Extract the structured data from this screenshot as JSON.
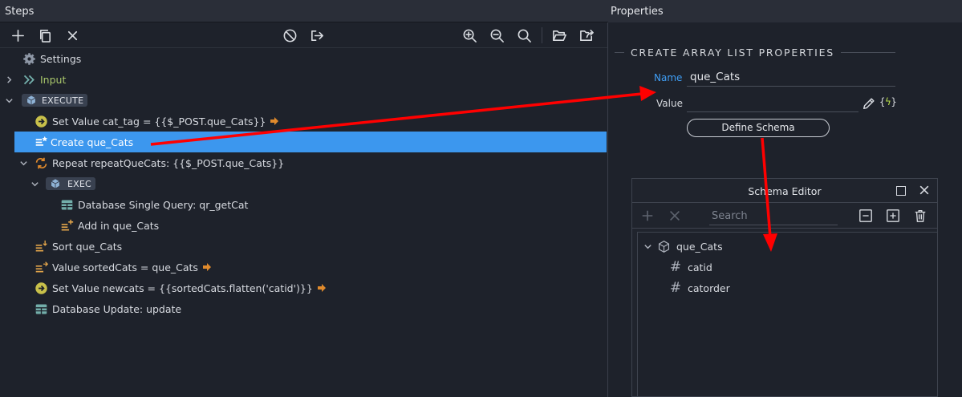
{
  "steps_panel": {
    "title": "Steps",
    "rows": [
      {
        "label": "Settings"
      },
      {
        "label": "Input"
      },
      {
        "label": "EXECUTE"
      },
      {
        "label": "Set Value cat_tag = {{$_POST.que_Cats}}"
      },
      {
        "label": "Create que_Cats"
      },
      {
        "label": "Repeat repeatQueCats: {{$_POST.que_Cats}}"
      },
      {
        "label": "EXEC"
      },
      {
        "label": "Database Single Query: qr_getCat"
      },
      {
        "label": "Add in que_Cats"
      },
      {
        "label": "Sort que_Cats"
      },
      {
        "label": "Value sortedCats = que_Cats"
      },
      {
        "label": "Set Value newcats = {{sortedCats.flatten('catid')}}"
      },
      {
        "label": "Database Update: update"
      }
    ]
  },
  "properties_panel": {
    "title": "Properties",
    "section_title": "CREATE ARRAY LIST PROPERTIES",
    "name_label": "Name",
    "name_value": "que_Cats",
    "value_label": "Value",
    "value_value": "",
    "dynamic_open": "{",
    "dynamic_bolt": "ϟ",
    "dynamic_close": "}",
    "define_schema_label": "Define Schema"
  },
  "schema_editor": {
    "title": "Schema Editor",
    "search_placeholder": "Search",
    "root": "que_Cats",
    "fields": [
      "catid",
      "catorder"
    ]
  },
  "colors": {
    "selection": "#3c97ee",
    "accent_blue": "#3f9ef5",
    "input_green": "#a8c66b",
    "annotation_arrow": "#ff0000",
    "set_value_icon": "#c8c04a",
    "repeat_icon": "#e08a2c",
    "db_icon": "#73aeaa"
  }
}
